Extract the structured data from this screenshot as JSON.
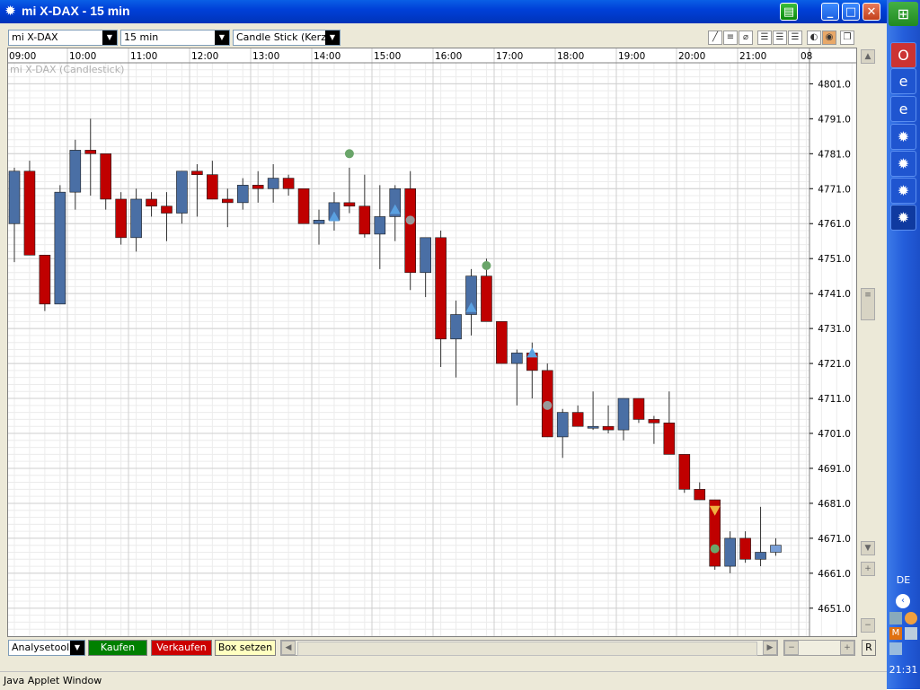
{
  "window": {
    "title": "mi X-DAX - 15 min",
    "status_text": "Java Applet Window"
  },
  "toolbar": {
    "instrument": "mi X-DAX",
    "interval": "15 min",
    "chart_type": "Candle Stick (Kerzen"
  },
  "bottom": {
    "analysetool": "Analysetool",
    "kaufen": "Kaufen",
    "verkaufen": "Verkaufen",
    "box_setzen": "Box setzen",
    "r_label": "R"
  },
  "taskbar": {
    "lang": "DE",
    "clock": "21:31"
  },
  "colors": {
    "up": "#4a6fa5",
    "down": "#c00000",
    "kaufen": "#008000",
    "verkaufen": "#cc0000",
    "box": "#ffffc0"
  },
  "chart_data": {
    "type": "candlestick",
    "title": "mi X-DAX (Candlestick)",
    "x_ticks": [
      "09:00",
      "10:00",
      "11:00",
      "12:00",
      "13:00",
      "14:00",
      "15:00",
      "16:00",
      "17:00",
      "18:00",
      "19:00",
      "20:00",
      "21:00",
      "08"
    ],
    "y_ticks": [
      4801.0,
      4791.0,
      4781.0,
      4771.0,
      4761.0,
      4751.0,
      4741.0,
      4731.0,
      4721.0,
      4711.0,
      4701.0,
      4691.0,
      4681.0,
      4671.0,
      4661.0,
      4651.0
    ],
    "ylim": [
      4643.0,
      4807.0
    ],
    "grid": true,
    "interval_minutes": 15,
    "candles": [
      {
        "t": "09:00",
        "o": 4761.0,
        "h": 4777.0,
        "l": 4750.0,
        "c": 4776.0
      },
      {
        "t": "09:15",
        "o": 4776.0,
        "h": 4779.0,
        "l": 4752.0,
        "c": 4752.0
      },
      {
        "t": "09:30",
        "o": 4752.0,
        "h": 4752.0,
        "l": 4736.0,
        "c": 4738.0
      },
      {
        "t": "09:45",
        "o": 4738.0,
        "h": 4772.0,
        "l": 4738.0,
        "c": 4770.0
      },
      {
        "t": "10:00",
        "o": 4770.0,
        "h": 4785.0,
        "l": 4765.0,
        "c": 4782.0
      },
      {
        "t": "10:15",
        "o": 4782.0,
        "h": 4791.0,
        "l": 4769.0,
        "c": 4781.0
      },
      {
        "t": "10:30",
        "o": 4781.0,
        "h": 4781.0,
        "l": 4765.0,
        "c": 4768.0
      },
      {
        "t": "10:45",
        "o": 4768.0,
        "h": 4770.0,
        "l": 4755.0,
        "c": 4757.0
      },
      {
        "t": "11:00",
        "o": 4757.0,
        "h": 4771.0,
        "l": 4753.0,
        "c": 4768.0
      },
      {
        "t": "11:15",
        "o": 4768.0,
        "h": 4770.0,
        "l": 4763.0,
        "c": 4766.0
      },
      {
        "t": "11:30",
        "o": 4766.0,
        "h": 4770.0,
        "l": 4756.0,
        "c": 4764.0
      },
      {
        "t": "11:45",
        "o": 4764.0,
        "h": 4776.0,
        "l": 4761.0,
        "c": 4776.0
      },
      {
        "t": "12:00",
        "o": 4776.0,
        "h": 4778.0,
        "l": 4763.0,
        "c": 4775.0
      },
      {
        "t": "12:15",
        "o": 4775.0,
        "h": 4779.0,
        "l": 4768.0,
        "c": 4768.0
      },
      {
        "t": "12:30",
        "o": 4768.0,
        "h": 4771.0,
        "l": 4760.0,
        "c": 4767.0
      },
      {
        "t": "12:45",
        "o": 4767.0,
        "h": 4774.0,
        "l": 4765.0,
        "c": 4772.0
      },
      {
        "t": "13:00",
        "o": 4772.0,
        "h": 4776.0,
        "l": 4767.0,
        "c": 4771.0
      },
      {
        "t": "13:15",
        "o": 4771.0,
        "h": 4778.0,
        "l": 4767.0,
        "c": 4774.0
      },
      {
        "t": "13:30",
        "o": 4774.0,
        "h": 4775.0,
        "l": 4769.0,
        "c": 4771.0
      },
      {
        "t": "13:45",
        "o": 4771.0,
        "h": 4771.0,
        "l": 4761.0,
        "c": 4761.0
      },
      {
        "t": "14:00",
        "o": 4761.0,
        "h": 4765.0,
        "l": 4755.0,
        "c": 4762.0
      },
      {
        "t": "14:15",
        "o": 4762.0,
        "h": 4770.0,
        "l": 4759.0,
        "c": 4767.0
      },
      {
        "t": "14:30",
        "o": 4767.0,
        "h": 4777.0,
        "l": 4764.0,
        "c": 4766.0
      },
      {
        "t": "14:45",
        "o": 4766.0,
        "h": 4775.0,
        "l": 4757.0,
        "c": 4758.0
      },
      {
        "t": "15:00",
        "o": 4758.0,
        "h": 4772.0,
        "l": 4748.0,
        "c": 4763.0
      },
      {
        "t": "15:15",
        "o": 4763.0,
        "h": 4772.0,
        "l": 4756.0,
        "c": 4771.0
      },
      {
        "t": "15:30",
        "o": 4771.0,
        "h": 4776.0,
        "l": 4742.0,
        "c": 4747.0
      },
      {
        "t": "15:45",
        "o": 4747.0,
        "h": 4757.0,
        "l": 4740.0,
        "c": 4757.0
      },
      {
        "t": "16:00",
        "o": 4757.0,
        "h": 4759.0,
        "l": 4720.0,
        "c": 4728.0
      },
      {
        "t": "16:15",
        "o": 4728.0,
        "h": 4739.0,
        "l": 4717.0,
        "c": 4735.0
      },
      {
        "t": "16:30",
        "o": 4735.0,
        "h": 4748.0,
        "l": 4729.0,
        "c": 4746.0
      },
      {
        "t": "16:45",
        "o": 4746.0,
        "h": 4751.0,
        "l": 4733.0,
        "c": 4733.0
      },
      {
        "t": "17:00",
        "o": 4733.0,
        "h": 4733.0,
        "l": 4721.0,
        "c": 4721.0
      },
      {
        "t": "17:15",
        "o": 4721.0,
        "h": 4725.0,
        "l": 4709.0,
        "c": 4724.0
      },
      {
        "t": "17:30",
        "o": 4724.0,
        "h": 4727.0,
        "l": 4711.0,
        "c": 4719.0
      },
      {
        "t": "17:45",
        "o": 4719.0,
        "h": 4721.0,
        "l": 4700.0,
        "c": 4700.0
      },
      {
        "t": "18:00",
        "o": 4700.0,
        "h": 4708.0,
        "l": 4694.0,
        "c": 4707.0
      },
      {
        "t": "18:15",
        "o": 4707.0,
        "h": 4709.0,
        "l": 4703.0,
        "c": 4703.0
      },
      {
        "t": "18:30",
        "o": 4703.0,
        "h": 4713.0,
        "l": 4702.0,
        "c": 4703.0
      },
      {
        "t": "18:45",
        "o": 4703.0,
        "h": 4709.0,
        "l": 4701.0,
        "c": 4702.0
      },
      {
        "t": "19:00",
        "o": 4702.0,
        "h": 4711.0,
        "l": 4699.0,
        "c": 4711.0
      },
      {
        "t": "19:15",
        "o": 4711.0,
        "h": 4711.0,
        "l": 4704.0,
        "c": 4705.0
      },
      {
        "t": "19:30",
        "o": 4705.0,
        "h": 4706.0,
        "l": 4698.0,
        "c": 4704.0
      },
      {
        "t": "19:45",
        "o": 4704.0,
        "h": 4713.0,
        "l": 4695.0,
        "c": 4695.0
      },
      {
        "t": "20:00",
        "o": 4695.0,
        "h": 4695.0,
        "l": 4684.0,
        "c": 4685.0
      },
      {
        "t": "20:15",
        "o": 4685.0,
        "h": 4687.0,
        "l": 4682.0,
        "c": 4682.0
      },
      {
        "t": "20:30",
        "o": 4682.0,
        "h": 4682.0,
        "l": 4662.0,
        "c": 4663.0
      },
      {
        "t": "20:45",
        "o": 4663.0,
        "h": 4673.0,
        "l": 4661.0,
        "c": 4671.0
      },
      {
        "t": "21:00",
        "o": 4671.0,
        "h": 4673.0,
        "l": 4664.0,
        "c": 4665.0
      },
      {
        "t": "21:15",
        "o": 4665.0,
        "h": 4680.0,
        "l": 4663.0,
        "c": 4667.0
      },
      {
        "t": "21:30",
        "o": 4667.0,
        "h": 4671.0,
        "l": 4666.0,
        "c": 4669.0
      }
    ],
    "markers": [
      {
        "i": 22,
        "y": 4781.0,
        "kind": "circle",
        "color": "#6aa56a"
      },
      {
        "i": 21,
        "y": 4763.0,
        "kind": "triangle-up",
        "color": "#5aa0e0"
      },
      {
        "i": 25,
        "y": 4765.0,
        "kind": "triangle-up",
        "color": "#5aa0e0"
      },
      {
        "i": 26,
        "y": 4762.0,
        "kind": "circle",
        "color": "#999999"
      },
      {
        "i": 31,
        "y": 4749.0,
        "kind": "circle",
        "color": "#6aa56a"
      },
      {
        "i": 30,
        "y": 4737.0,
        "kind": "triangle-up",
        "color": "#5aa0e0"
      },
      {
        "i": 34,
        "y": 4724.0,
        "kind": "triangle-up",
        "color": "#5aa0e0"
      },
      {
        "i": 35,
        "y": 4709.0,
        "kind": "circle",
        "color": "#999999"
      },
      {
        "i": 46,
        "y": 4679.0,
        "kind": "triangle-down",
        "color": "#f0b040"
      },
      {
        "i": 46,
        "y": 4668.0,
        "kind": "circle",
        "color": "#6aa56a"
      }
    ]
  }
}
